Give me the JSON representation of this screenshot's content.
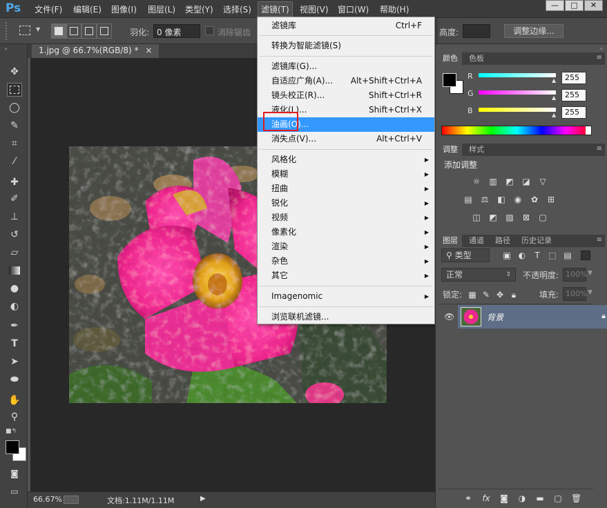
{
  "app": {
    "logo": "Ps"
  },
  "menubar": {
    "items": [
      "文件(F)",
      "编辑(E)",
      "图像(I)",
      "图层(L)",
      "类型(Y)",
      "选择(S)",
      "滤镜(T)",
      "视图(V)",
      "窗口(W)",
      "帮助(H)"
    ],
    "active": "滤镜(T)",
    "window_buttons": [
      "—",
      "□",
      "✕"
    ]
  },
  "options": {
    "feather_label": "羽化:",
    "feather_value": "0 像素",
    "antialias_label": "消除锯齿",
    "height_label": "高度:",
    "refine_edge_label": "调整边缘..."
  },
  "document": {
    "tab_title": "1.jpg @ 66.7%(RGB/8) *",
    "close": "×"
  },
  "status": {
    "zoom": "66.67%",
    "doc_info": "文档:1.11M/1.11M"
  },
  "filter_menu": {
    "last_filter": {
      "label": "滤镜库",
      "shortcut": "Ctrl+F"
    },
    "smart": {
      "label": "转换为智能滤镜(S)"
    },
    "group1": [
      {
        "label": "滤镜库(G)...",
        "shortcut": ""
      },
      {
        "label": "自适应广角(A)...",
        "shortcut": "Alt+Shift+Ctrl+A"
      },
      {
        "label": "镜头校正(R)...",
        "shortcut": "Shift+Ctrl+R"
      },
      {
        "label": "液化(L)...",
        "shortcut": "Shift+Ctrl+X"
      },
      {
        "label": "油画(O)...",
        "shortcut": "",
        "highlighted": true
      },
      {
        "label": "消失点(V)...",
        "shortcut": "Alt+Ctrl+V"
      }
    ],
    "submenus": [
      "风格化",
      "模糊",
      "扭曲",
      "锐化",
      "视频",
      "像素化",
      "渲染",
      "杂色",
      "其它"
    ],
    "plugin": "Imagenomic",
    "browse": "浏览联机滤镜..."
  },
  "color_panel": {
    "tabs": [
      "颜色",
      "色板"
    ],
    "channels": [
      {
        "name": "R",
        "value": "255",
        "gradient_from": "#00ffff",
        "gradient_to": "#ffffff"
      },
      {
        "name": "G",
        "value": "255",
        "gradient_from": "#ff00ff",
        "gradient_to": "#ffffff"
      },
      {
        "name": "B",
        "value": "255",
        "gradient_from": "#ffff00",
        "gradient_to": "#ffffff"
      }
    ]
  },
  "adjust_panel": {
    "tabs": [
      "调整",
      "样式"
    ],
    "title": "添加调整"
  },
  "layers_panel": {
    "tabs": [
      "图层",
      "通道",
      "路径",
      "历史记录"
    ],
    "filter_kind": "类型",
    "blend_mode": "正常",
    "opacity_label": "不透明度:",
    "opacity_value": "100%",
    "lock_label": "锁定:",
    "fill_label": "填充:",
    "fill_value": "100%",
    "layer_name": "背景"
  },
  "colors": {
    "accent": "#3399ff",
    "highlight_box": "#e21d1d",
    "layer_selected": "#5e6e86"
  }
}
